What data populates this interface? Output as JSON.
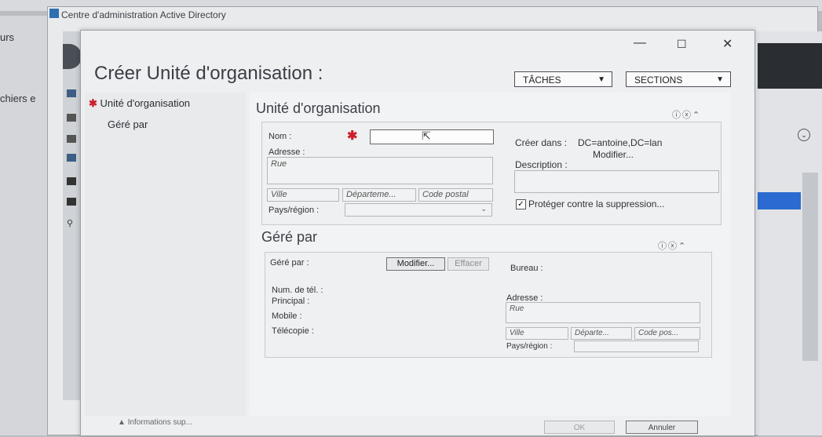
{
  "parent_window": {
    "title": "Centre d'administration Active Directory",
    "left_text_1": "urs",
    "left_text_2": "chiers e"
  },
  "dialog": {
    "title": "Créer Unité d'organisation :",
    "minimize": "—",
    "maximize": "☐",
    "close": "✕",
    "tasks_label": "TÂCHES",
    "sections_label": "SECTIONS",
    "nav": [
      {
        "label": "Unité d'organisation",
        "required": true
      },
      {
        "label": "Géré par",
        "required": false
      }
    ],
    "more_info": "Informations sup...",
    "ok": "OK",
    "cancel": "Annuler"
  },
  "ou_section": {
    "title": "Unité d'organisation",
    "name_label": "Nom :",
    "name_value": "",
    "address_label": "Adresse :",
    "street_placeholder": "Rue",
    "city_placeholder": "Ville",
    "department_placeholder": "Départeme...",
    "postal_placeholder": "Code postal",
    "country_label": "Pays/région :",
    "create_in_label": "Créer dans :",
    "create_in_value": "DC=antoine,DC=lan",
    "modify_link": "Modifier...",
    "description_label": "Description :",
    "protect_label": "Protéger contre la suppression...",
    "protect_checked": true
  },
  "managed_section": {
    "title": "Géré par",
    "managed_label": "Géré par :",
    "modify_button": "Modifier...",
    "clear_button": "Effacer",
    "office_label": "Bureau :",
    "phone_label": "Num. de tél. :",
    "main_label": "Principal :",
    "mobile_label": "Mobile :",
    "fax_label": "Télécopie :",
    "address_label": "Adresse :",
    "street_placeholder": "Rue",
    "city_placeholder": "Ville",
    "department_placeholder": "Départe...",
    "postal_placeholder": "Code pos...",
    "country_label": "Pays/région :"
  }
}
